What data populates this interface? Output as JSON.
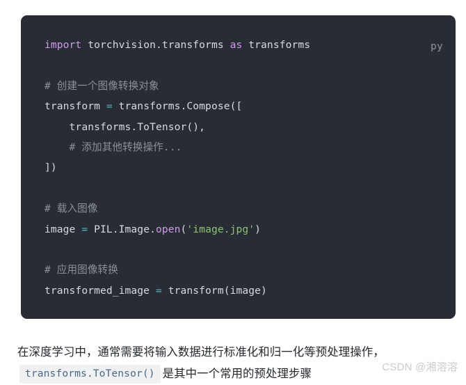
{
  "code_block": {
    "language_label": "py",
    "background_color": "#282c34",
    "lines": [
      {
        "id": "line-import",
        "tokens": [
          {
            "text": "import",
            "type": "keyword"
          },
          {
            "text": " torchvision.transforms ",
            "type": "plain"
          },
          {
            "text": "as",
            "type": "keyword"
          },
          {
            "text": " transforms",
            "type": "plain"
          }
        ]
      },
      {
        "id": "line-blank-1",
        "tokens": []
      },
      {
        "id": "line-comment-create",
        "tokens": [
          {
            "text": "# 创建一个图像转换对象",
            "type": "comment"
          }
        ]
      },
      {
        "id": "line-transform-assign",
        "tokens": [
          {
            "text": "transform ",
            "type": "plain"
          },
          {
            "text": "=",
            "type": "operator"
          },
          {
            "text": " transforms.Compose([",
            "type": "plain"
          }
        ]
      },
      {
        "id": "line-totensor",
        "tokens": [
          {
            "text": "    transforms.ToTensor(),",
            "type": "plain"
          }
        ]
      },
      {
        "id": "line-comment-add-other",
        "tokens": [
          {
            "text": "    # 添加其他转换操作...",
            "type": "comment"
          }
        ]
      },
      {
        "id": "line-close-bracket",
        "tokens": [
          {
            "text": "])",
            "type": "plain"
          }
        ]
      },
      {
        "id": "line-blank-2",
        "tokens": []
      },
      {
        "id": "line-comment-load",
        "tokens": [
          {
            "text": "# 载入图像",
            "type": "comment"
          }
        ]
      },
      {
        "id": "line-image-open",
        "tokens": [
          {
            "text": "image ",
            "type": "plain"
          },
          {
            "text": "=",
            "type": "operator"
          },
          {
            "text": " PIL.Image.",
            "type": "plain"
          },
          {
            "text": "open",
            "type": "function"
          },
          {
            "text": "(",
            "type": "plain"
          },
          {
            "text": "'image.jpg'",
            "type": "string"
          },
          {
            "text": ")",
            "type": "plain"
          }
        ]
      },
      {
        "id": "line-blank-3",
        "tokens": []
      },
      {
        "id": "line-comment-apply",
        "tokens": [
          {
            "text": "# 应用图像转换",
            "type": "comment"
          }
        ]
      },
      {
        "id": "line-transformed-image",
        "tokens": [
          {
            "text": "transformed_image ",
            "type": "plain"
          },
          {
            "text": "=",
            "type": "operator"
          },
          {
            "text": " transform(image)",
            "type": "plain"
          }
        ]
      }
    ]
  },
  "paragraph": {
    "text_before": "在深度学习中，通常需要将输入数据进行标准化和归一化等预处理操作，",
    "inline_code": "transforms.ToTensor()",
    "text_after": "是其中一个常用的预处理步骤"
  },
  "watermark": {
    "text": "CSDN @湘溶溶"
  },
  "colors": {
    "code_background": "#282c34",
    "keyword": "#d39bec",
    "operator": "#57b6c2",
    "string": "#8cc473",
    "comment": "#8b9199",
    "code_text": "#d7dae0",
    "language_label": "#8f949e",
    "body_text": "#25292e",
    "inline_code_bg": "#f0f1f2",
    "inline_code_text": "#4b6a86",
    "watermark": "#c9cbcd"
  }
}
